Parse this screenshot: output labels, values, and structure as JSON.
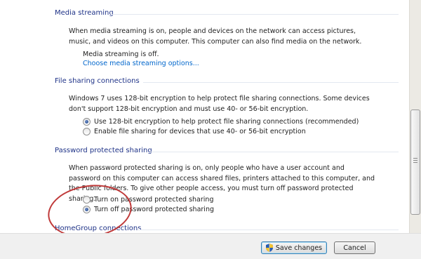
{
  "media_streaming": {
    "header": "Media streaming",
    "description": "When media streaming is on, people and devices on the network can access pictures, music, and videos on this computer. This computer can also find media on the network.",
    "status": "Media streaming is off.",
    "link": "Choose media streaming options..."
  },
  "file_sharing": {
    "header": "File sharing connections",
    "description": "Windows 7 uses 128-bit encryption to help protect file sharing connections. Some devices don't support 128-bit encryption and must use 40- or 56-bit encryption.",
    "options": [
      {
        "label": "Use 128-bit encryption to help protect file sharing connections (recommended)",
        "checked": true
      },
      {
        "label": "Enable file sharing for devices that use 40- or 56-bit encryption",
        "checked": false
      }
    ]
  },
  "password_sharing": {
    "header": "Password protected sharing",
    "description": "When password protected sharing is on, only people who have a user account and password on this computer can access shared files, printers attached to this computer, and the Public folders. To give other people access, you must turn off password protected sharing.",
    "options": [
      {
        "label": "Turn on password protected sharing",
        "checked": false
      },
      {
        "label": "Turn off password protected sharing",
        "checked": true
      }
    ]
  },
  "homegroup": {
    "header": "HomeGroup connections"
  },
  "buttons": {
    "save": "Save changes",
    "cancel": "Cancel"
  },
  "colors": {
    "header_text": "#1e3287",
    "link": "#0066cc",
    "annotation_circle": "#c03a3a"
  }
}
